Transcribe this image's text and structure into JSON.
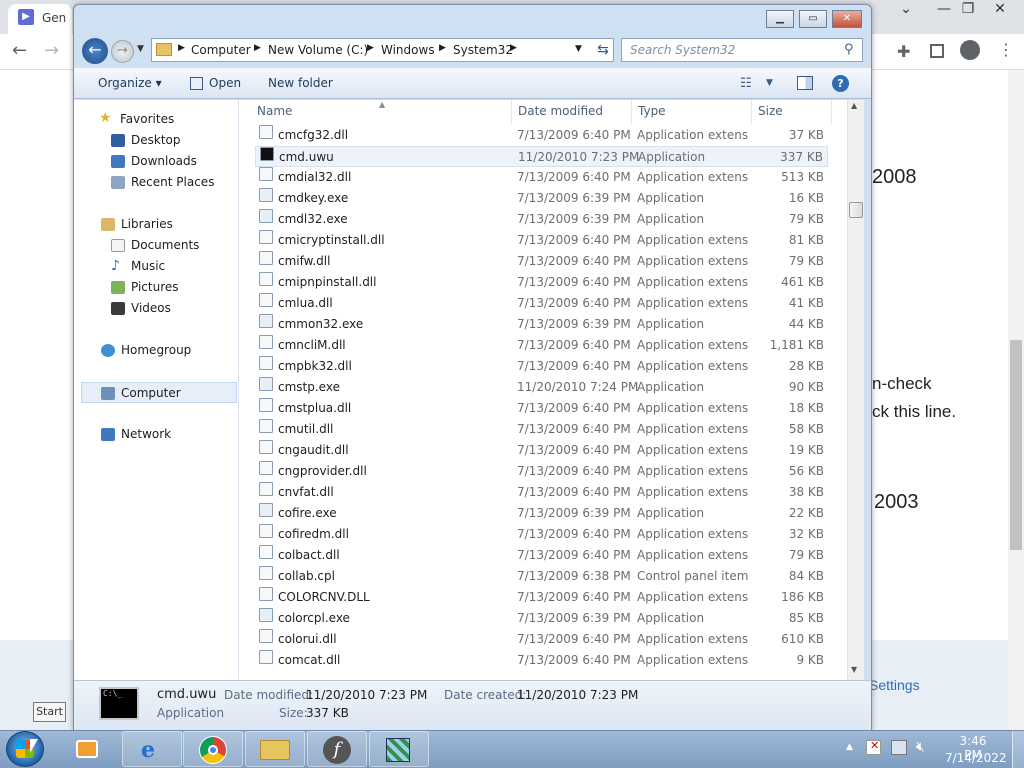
{
  "browser": {
    "tab_title": "Gen",
    "nav": {
      "back": "←",
      "forward": "→"
    },
    "page_texts": [
      "2008",
      "n-check",
      "ck this line.",
      "2003",
      "Settings"
    ]
  },
  "window": {
    "caption_buttons": [
      "minimize",
      "maximize",
      "close"
    ],
    "breadcrumb": [
      "Computer",
      "New Volume (C:)",
      "Windows",
      "System32"
    ],
    "search_placeholder": "Search System32",
    "toolbar": {
      "organize": "Organize ▾",
      "open": "Open",
      "new_folder": "New folder"
    },
    "nav_pane": {
      "favorites_label": "Favorites",
      "favorites": [
        "Desktop",
        "Downloads",
        "Recent Places"
      ],
      "libraries_label": "Libraries",
      "libraries": [
        "Documents",
        "Music",
        "Pictures",
        "Videos"
      ],
      "homegroup": "Homegroup",
      "computer": "Computer",
      "network": "Network"
    },
    "columns": {
      "name": "Name",
      "date": "Date modified",
      "type": "Type",
      "size": "Size"
    },
    "files": [
      {
        "name": "cmcfg32.dll",
        "date": "7/13/2009 6:40 PM",
        "type": "Application extens...",
        "size": "37 KB"
      },
      {
        "name": "cmd.uwu",
        "date": "11/20/2010 7:23 PM",
        "type": "Application",
        "size": "337 KB",
        "selected": true
      },
      {
        "name": "cmdial32.dll",
        "date": "7/13/2009 6:40 PM",
        "type": "Application extens...",
        "size": "513 KB"
      },
      {
        "name": "cmdkey.exe",
        "date": "7/13/2009 6:39 PM",
        "type": "Application",
        "size": "16 KB"
      },
      {
        "name": "cmdl32.exe",
        "date": "7/13/2009 6:39 PM",
        "type": "Application",
        "size": "79 KB"
      },
      {
        "name": "cmicryptinstall.dll",
        "date": "7/13/2009 6:40 PM",
        "type": "Application extens...",
        "size": "81 KB"
      },
      {
        "name": "cmifw.dll",
        "date": "7/13/2009 6:40 PM",
        "type": "Application extens...",
        "size": "79 KB"
      },
      {
        "name": "cmipnpinstall.dll",
        "date": "7/13/2009 6:40 PM",
        "type": "Application extens...",
        "size": "461 KB"
      },
      {
        "name": "cmlua.dll",
        "date": "7/13/2009 6:40 PM",
        "type": "Application extens...",
        "size": "41 KB"
      },
      {
        "name": "cmmon32.exe",
        "date": "7/13/2009 6:39 PM",
        "type": "Application",
        "size": "44 KB"
      },
      {
        "name": "cmncliM.dll",
        "date": "7/13/2009 6:40 PM",
        "type": "Application extens...",
        "size": "1,181 KB"
      },
      {
        "name": "cmpbk32.dll",
        "date": "7/13/2009 6:40 PM",
        "type": "Application extens...",
        "size": "28 KB"
      },
      {
        "name": "cmstp.exe",
        "date": "11/20/2010 7:24 PM",
        "type": "Application",
        "size": "90 KB"
      },
      {
        "name": "cmstplua.dll",
        "date": "7/13/2009 6:40 PM",
        "type": "Application extens...",
        "size": "18 KB"
      },
      {
        "name": "cmutil.dll",
        "date": "7/13/2009 6:40 PM",
        "type": "Application extens...",
        "size": "58 KB"
      },
      {
        "name": "cngaudit.dll",
        "date": "7/13/2009 6:40 PM",
        "type": "Application extens...",
        "size": "19 KB"
      },
      {
        "name": "cngprovider.dll",
        "date": "7/13/2009 6:40 PM",
        "type": "Application extens...",
        "size": "56 KB"
      },
      {
        "name": "cnvfat.dll",
        "date": "7/13/2009 6:40 PM",
        "type": "Application extens...",
        "size": "38 KB"
      },
      {
        "name": "cofire.exe",
        "date": "7/13/2009 6:39 PM",
        "type": "Application",
        "size": "22 KB"
      },
      {
        "name": "cofiredm.dll",
        "date": "7/13/2009 6:40 PM",
        "type": "Application extens...",
        "size": "32 KB"
      },
      {
        "name": "colbact.dll",
        "date": "7/13/2009 6:40 PM",
        "type": "Application extens...",
        "size": "79 KB"
      },
      {
        "name": "collab.cpl",
        "date": "7/13/2009 6:38 PM",
        "type": "Control panel item",
        "size": "84 KB"
      },
      {
        "name": "COLORCNV.DLL",
        "date": "7/13/2009 6:40 PM",
        "type": "Application extens...",
        "size": "186 KB"
      },
      {
        "name": "colorcpl.exe",
        "date": "7/13/2009 6:39 PM",
        "type": "Application",
        "size": "85 KB"
      },
      {
        "name": "colorui.dll",
        "date": "7/13/2009 6:40 PM",
        "type": "Application extens...",
        "size": "610 KB"
      },
      {
        "name": "comcat.dll",
        "date": "7/13/2009 6:40 PM",
        "type": "Application extens...",
        "size": "9 KB"
      }
    ],
    "details": {
      "filename": "cmd.uwu",
      "type": "Application",
      "modified_label": "Date modified:",
      "modified": "11/20/2010 7:23 PM",
      "created_label": "Date created:",
      "created": "11/20/2010 7:23 PM",
      "size_label": "Size:",
      "size": "337 KB"
    }
  },
  "taskbar": {
    "start_tooltip": "Start",
    "apps": [
      "media-player-icon",
      "internet-explorer-icon",
      "chrome-icon",
      "explorer-folder-icon",
      "flash-icon",
      "app-cube-icon"
    ],
    "time": "3:46 PM",
    "date": "7/14/2022"
  }
}
